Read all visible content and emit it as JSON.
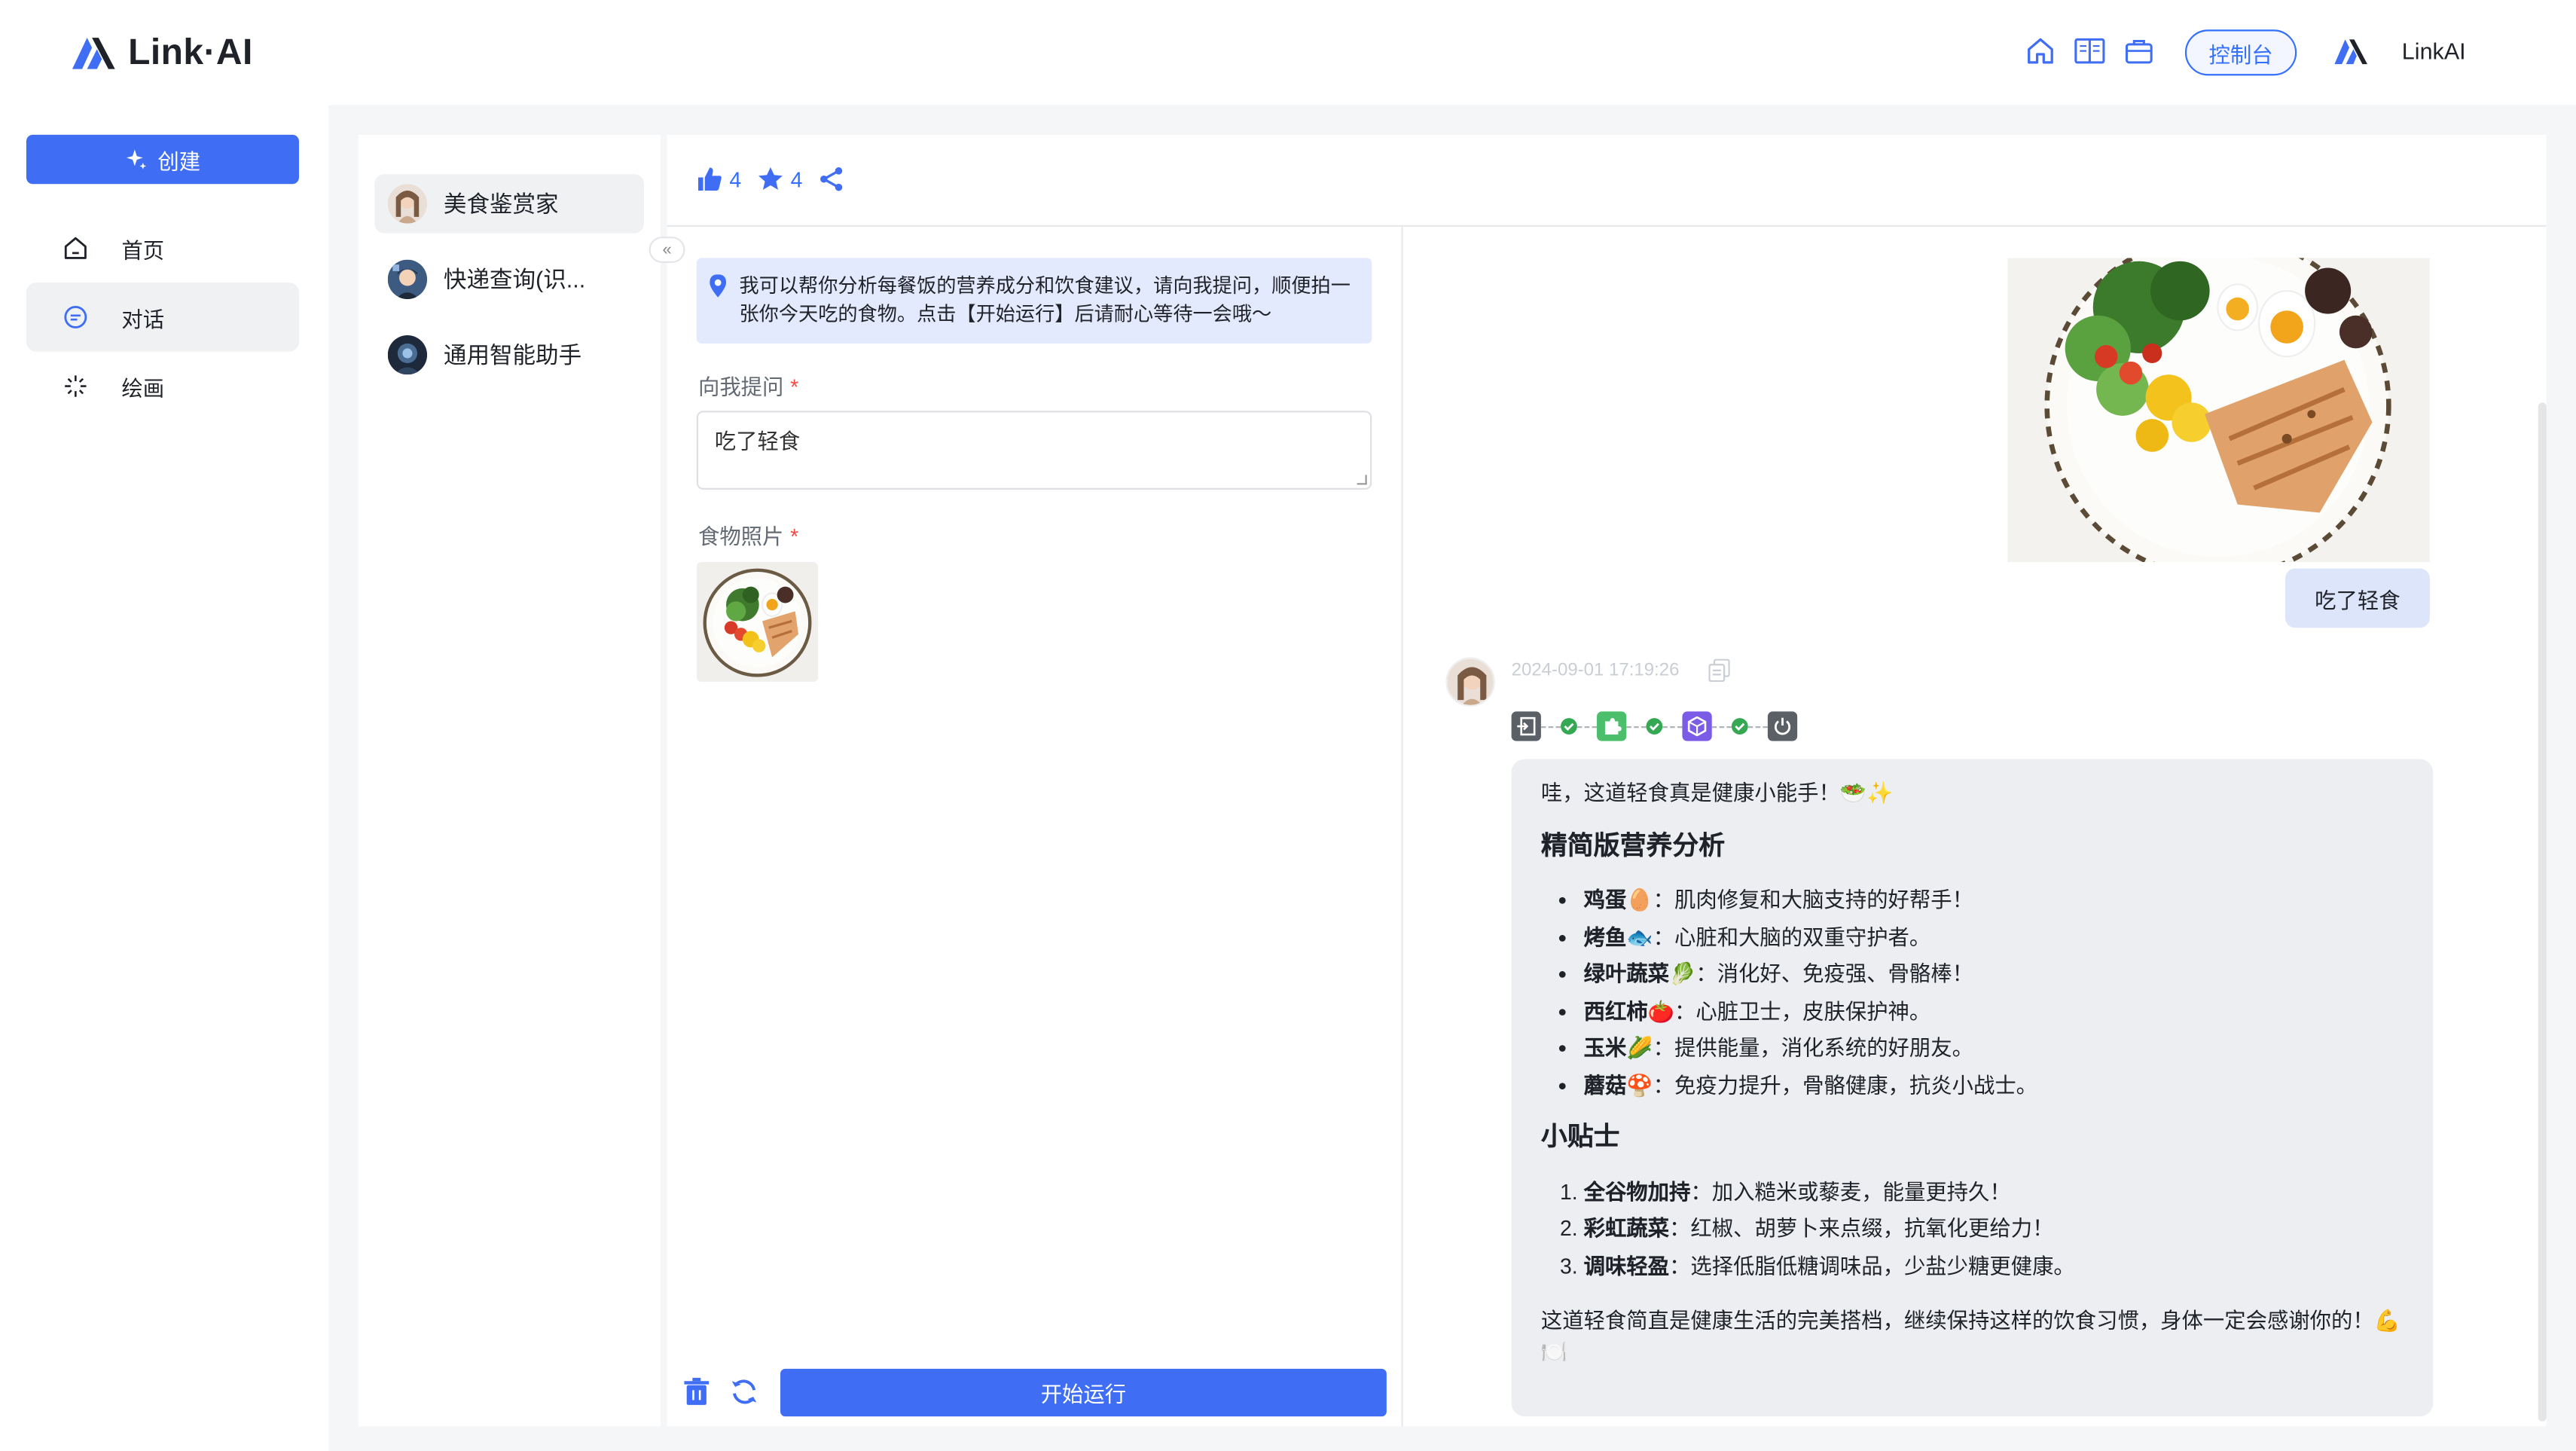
{
  "brand": {
    "name": "Link·AI"
  },
  "header": {
    "console_label": "控制台",
    "user_name": "LinkAI",
    "icons": [
      "home-icon",
      "book-icon",
      "briefcase-icon"
    ]
  },
  "sidebar": {
    "create_label": "创建",
    "items": [
      {
        "label": "首页",
        "icon": "home-icon"
      },
      {
        "label": "对话",
        "icon": "chat-icon",
        "active": true
      },
      {
        "label": "绘画",
        "icon": "sparkle-icon"
      }
    ]
  },
  "agents": [
    {
      "name": "美食鉴赏家",
      "active": true
    },
    {
      "name": "快递查询(识..."
    },
    {
      "name": "通用智能助手"
    }
  ],
  "stats": {
    "likes": "4",
    "favorites": "4"
  },
  "form": {
    "tip": "我可以帮你分析每餐饭的营养成分和饮食建议，请向我提问，顺便拍一张你今天吃的食物。点击【开始运行】后请耐心等待一会哦～",
    "question_label": "向我提问",
    "question_value": "吃了轻食",
    "photo_label": "食物照片",
    "required_mark": "*",
    "run_label": "开始运行"
  },
  "chat": {
    "user_message": "吃了轻食",
    "timestamp": "2024-09-01 17:19:26",
    "answer": {
      "intro": "哇，这道轻食真是健康小能手！🥗✨",
      "section1_title": "精简版营养分析",
      "nutrients": [
        {
          "name": "鸡蛋",
          "emoji": "🥚",
          "desc": "：肌肉修复和大脑支持的好帮手！"
        },
        {
          "name": "烤鱼",
          "emoji": "🐟",
          "desc": "：心脏和大脑的双重守护者。"
        },
        {
          "name": "绿叶蔬菜",
          "emoji": "🥬",
          "desc": "：消化好、免疫强、骨骼棒！"
        },
        {
          "name": "西红柿",
          "emoji": "🍅",
          "desc": "：心脏卫士，皮肤保护神。"
        },
        {
          "name": "玉米",
          "emoji": "🌽",
          "desc": "：提供能量，消化系统的好朋友。"
        },
        {
          "name": "蘑菇",
          "emoji": "🍄",
          "desc": "：免疫力提升，骨骼健康，抗炎小战士。"
        }
      ],
      "section2_title": "小贴士",
      "tips": [
        {
          "name": "全谷物加持",
          "desc": "：加入糙米或藜麦，能量更持久！"
        },
        {
          "name": "彩虹蔬菜",
          "desc": "：红椒、胡萝卜来点缀，抗氧化更给力！"
        },
        {
          "name": "调味轻盈",
          "desc": "：选择低脂低糖调味品，少盐少糖更健康。"
        }
      ],
      "outro": "这道轻食简直是健康生活的完美搭档，继续保持这样的饮食习惯，身体一定会感谢你的！💪🍽️"
    }
  },
  "colors": {
    "accent": "#3f6ef5",
    "accent_light": "#dde5fa",
    "bubble_bg": "#eceef1"
  }
}
